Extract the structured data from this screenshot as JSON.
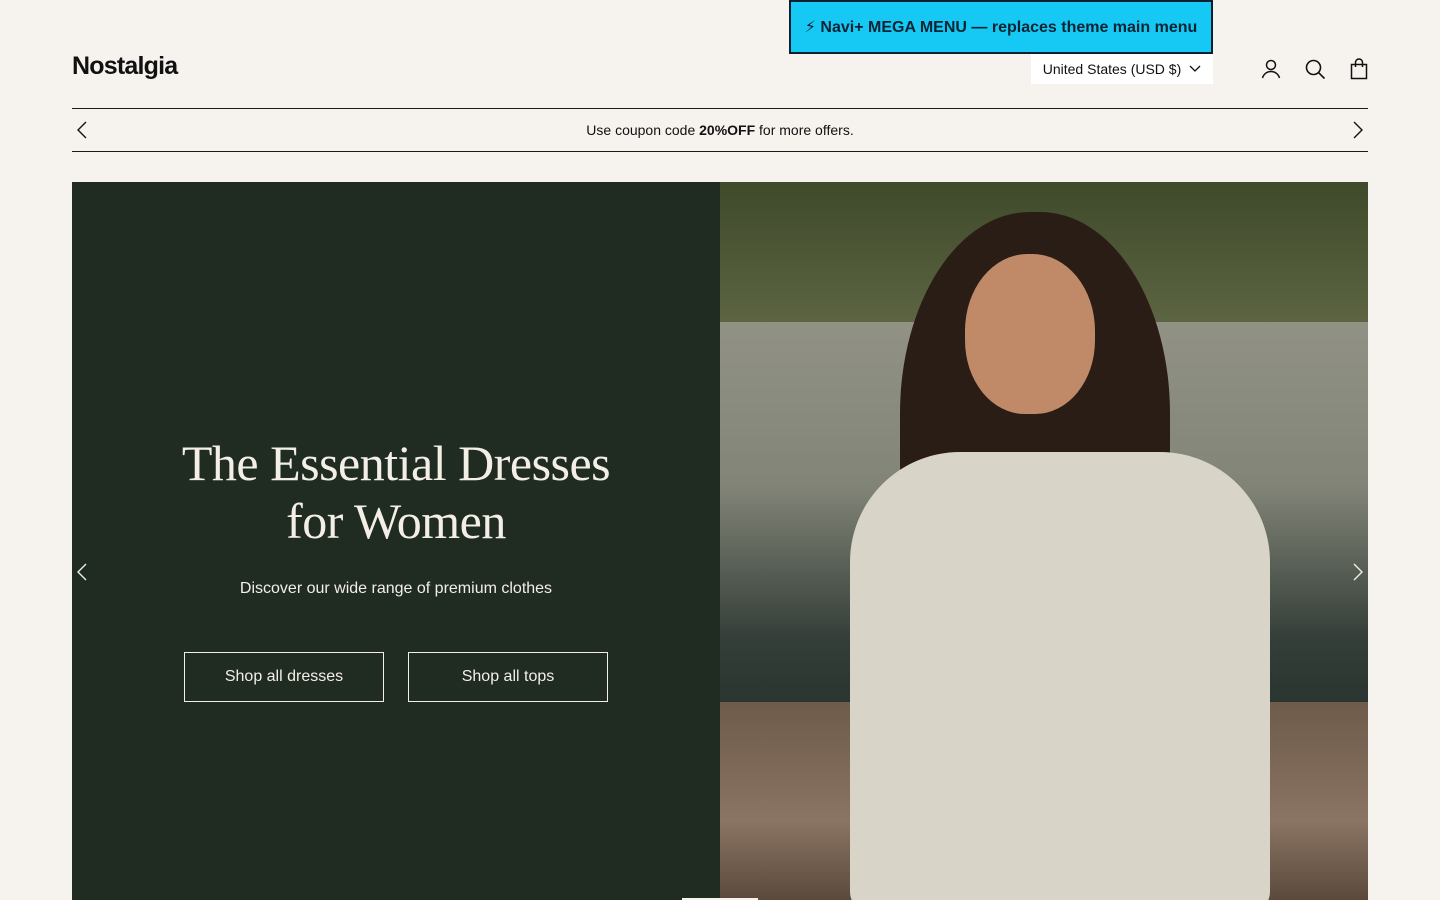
{
  "navi_banner": {
    "text": "⚡ Navi+ MEGA MENU — replaces theme main menu"
  },
  "header": {
    "logo": "Nostalgia",
    "currency_selector": "United States (USD $)",
    "icons": [
      "account-icon",
      "search-icon",
      "cart-icon"
    ]
  },
  "announcement": {
    "prefix": "Use coupon code ",
    "code": "20%OFF",
    "suffix": " for more offers."
  },
  "hero": {
    "title_line1": "The Essential Dresses",
    "title_line2": "for Women",
    "subtitle": "Discover our wide range of premium clothes",
    "buttons": [
      {
        "label": "Shop all dresses"
      },
      {
        "label": "Shop all tops"
      }
    ]
  },
  "colors": {
    "page_bg": "#f6f3ee",
    "hero_panel": "#202b21",
    "navi_banner": "#16c8f4"
  }
}
